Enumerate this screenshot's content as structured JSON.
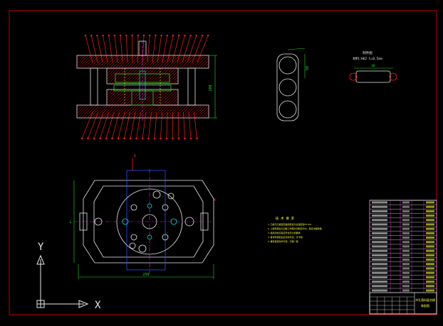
{
  "colors": {
    "background": "#000000",
    "frame": "#c00000",
    "drawing_white": "#e8e8e8",
    "leader_red": "#ff1a1a",
    "cyan": "#00e5e5",
    "green": "#22dd22",
    "magenta": "#e020e0",
    "yellow": "#ffff33",
    "blue": "#3050ff"
  },
  "section_view": {
    "height_dim": "200"
  },
  "side_view": {
    "height_dim": "50"
  },
  "part_view": {
    "header_line1": "制件图",
    "header_line2": "材料:H62  t=0.5mm",
    "width_dim": "40"
  },
  "plan_view": {
    "width_dim": "250",
    "depth_dim": "L",
    "marker_top": "A",
    "marker_right": "A"
  },
  "tech_notes": {
    "title": "技 术 要 求",
    "lines": [
      "1.凸模与凸模固定板的配合为过渡配合H7/m6.",
      "2.上模安装后凸凹模工作部分间隙应均匀，保证冲裁质量.",
      "3.模具闭合高度应符合压力机要求.",
      "4.各零件装配后应活动灵活，无卡阻.",
      "5.推件装置动作可靠，行程一致."
    ]
  },
  "axes": {
    "x": "X",
    "y": "Y"
  },
  "title_block": {
    "title": "冲孔落料复合模",
    "subtitle": "装配图"
  }
}
